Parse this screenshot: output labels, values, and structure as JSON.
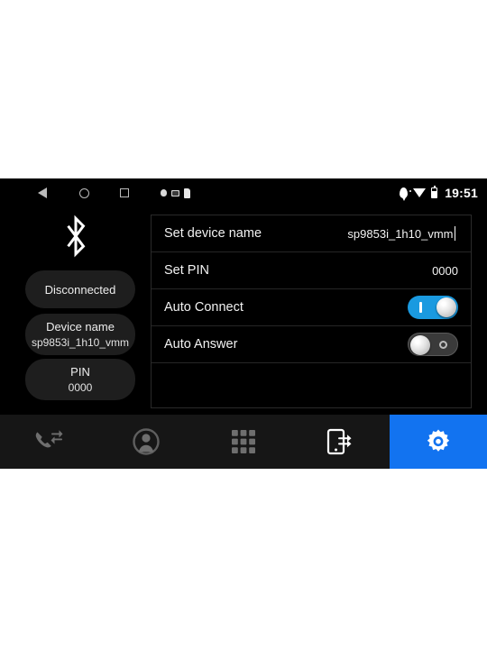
{
  "status_bar": {
    "nav": [
      {
        "name": "back",
        "icon": "triangle-back-icon"
      },
      {
        "name": "home",
        "icon": "circle-home-icon"
      },
      {
        "name": "recents",
        "icon": "square-recents-icon"
      }
    ],
    "left_icons": [
      "notification-dot-icon",
      "screenshot-image-icon",
      "sim-card-icon"
    ],
    "right_icons": [
      "location-pin-icon",
      "wifi-icon",
      "battery-icon"
    ],
    "clock": "19:51"
  },
  "sidebar": {
    "bluetooth_icon": "bluetooth-icon",
    "status_pill": {
      "label": "Disconnected"
    },
    "device_pill": {
      "title": "Device name",
      "value": "sp9853i_1h10_vmm"
    },
    "pin_pill": {
      "title": "PIN",
      "value": "0000"
    }
  },
  "settings": {
    "rows": [
      {
        "label": "Set device name",
        "value": "sp9853i_1h10_vmm",
        "type": "text"
      },
      {
        "label": "Set PIN",
        "value": "0000",
        "type": "text"
      },
      {
        "label": "Auto Connect",
        "value": "on",
        "type": "toggle"
      },
      {
        "label": "Auto Answer",
        "value": "off",
        "type": "toggle"
      }
    ]
  },
  "tabbar": {
    "items": [
      {
        "name": "call-log",
        "icon": "phone-call-log-icon",
        "active": false
      },
      {
        "name": "contacts",
        "icon": "person-contacts-icon",
        "active": false
      },
      {
        "name": "dialpad",
        "icon": "dialpad-grid-icon",
        "active": false
      },
      {
        "name": "device-sync",
        "icon": "phone-transfer-icon",
        "active": false
      },
      {
        "name": "settings",
        "icon": "gear-settings-icon",
        "active": true
      }
    ]
  },
  "colors": {
    "accent": "#1273f0",
    "toggle_on": "#1a9ae0",
    "toggle_off": "#3a3a3a",
    "screen_bg": "#000000",
    "tabbar_bg": "#161616",
    "pill_bg": "#1e1e1e"
  }
}
